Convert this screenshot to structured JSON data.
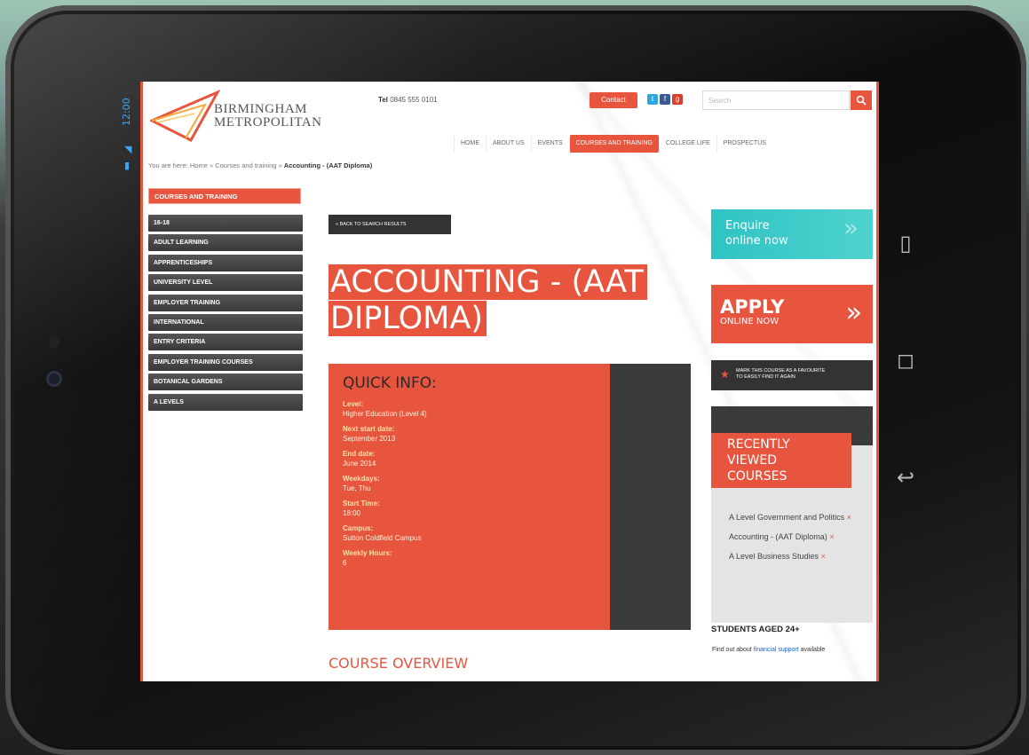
{
  "device": {
    "status_time": "12:00"
  },
  "header": {
    "logo_line1": "BIRMINGHAM",
    "logo_line2": "METROPOLITAN",
    "tel_label": "Tel",
    "tel_number": "0845 555 0101",
    "contact_label": "Contact",
    "search_placeholder": "Search"
  },
  "topnav": [
    {
      "label": "HOME"
    },
    {
      "label": "ABOUT US"
    },
    {
      "label": "EVENTS"
    },
    {
      "label": "COURSES AND TRAINING",
      "active": true
    },
    {
      "label": "COLLEGE LIFE"
    },
    {
      "label": "PROSPECTUS"
    }
  ],
  "breadcrumb": {
    "prefix": "You are here:",
    "home": "Home",
    "section": "Courses and training",
    "current": "Accounting - (AAT Diploma)"
  },
  "sidebar": {
    "heading": "COURSES AND TRAINING",
    "items": [
      {
        "label": "16-18"
      },
      {
        "label": "ADULT LEARNING"
      },
      {
        "label": "APPRENTICESHIPS"
      },
      {
        "label": "UNIVERSITY LEVEL"
      },
      {
        "label": "EMPLOYER TRAINING"
      },
      {
        "label": "INTERNATIONAL"
      },
      {
        "label": "ENTRY CRITERIA"
      },
      {
        "label": "EMPLOYER TRAINING COURSES"
      },
      {
        "label": "BOTANICAL GARDENS"
      },
      {
        "label": "A LEVELS"
      }
    ]
  },
  "main": {
    "back_label": "« BACK TO SEARCH RESULTS",
    "title_line1": "ACCOUNTING - (AAT",
    "title_line2": "DIPLOMA)",
    "quick_info": {
      "title": "QUICK INFO:",
      "rows": [
        {
          "label": "Level:",
          "value": "Higher Education (Level 4)"
        },
        {
          "label": "Next start date:",
          "value": "September 2013"
        },
        {
          "label": "End date:",
          "value": "June 2014"
        },
        {
          "label": "Weekdays:",
          "value": "Tue, Thu"
        },
        {
          "label": "Start Time:",
          "value": "18:00"
        },
        {
          "label": "Campus:",
          "value": "Sutton Coldfield Campus"
        },
        {
          "label": "Weekly Hours:",
          "value": "6"
        }
      ]
    },
    "overview_heading": "COURSE OVERVIEW"
  },
  "right": {
    "enquire_line1": "Enquire",
    "enquire_line2": "online now",
    "apply_big": "APPLY",
    "apply_small": "ONLINE NOW",
    "favourite_line1": "MARK THIS COURSE AS A FAVOURITE",
    "favourite_line2": "TO EASILY FIND IT AGAIN",
    "recent_heading_1": "RECENTLY",
    "recent_heading_2": "VIEWED",
    "recent_heading_3": "COURSES",
    "recent": [
      {
        "label": "A Level Government and Politics"
      },
      {
        "label": "Accounting - (AAT Diploma)"
      },
      {
        "label": "A Level Business Studies"
      }
    ],
    "students_heading": "STUDENTS AGED 24+",
    "students_text": "Find out about",
    "students_link": "financial support",
    "students_tail": "available"
  },
  "colors": {
    "accent": "#e8553f",
    "teal": "#2fc3c3",
    "dark": "#3a3a3a"
  }
}
